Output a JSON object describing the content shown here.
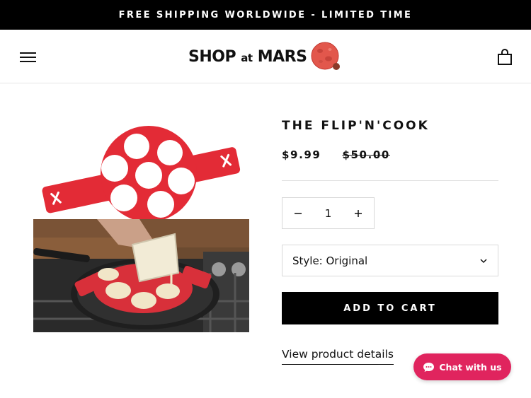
{
  "announcement": {
    "text": "FREE SHIPPING WORLDWIDE - LIMITED TIME"
  },
  "header": {
    "logo": {
      "main": "SHOP",
      "at": "at",
      "brand": "MARS"
    },
    "menu_icon": "hamburger-menu-icon",
    "cart_icon": "shopping-bag-icon"
  },
  "product": {
    "image_alt": "Red silicone pancake mold with seven circular holes",
    "title": "THE FLIP'N'COOK",
    "price": "$9.99",
    "compare_price": "$50.00",
    "quantity": {
      "value": "1",
      "minus_icon": "minus-icon",
      "plus_icon": "plus-icon"
    },
    "style_select": {
      "label": "Style: Original",
      "icon": "chevron-down-icon"
    },
    "add_to_cart": "ADD TO CART",
    "details_link": "View product details"
  },
  "chat": {
    "label": "Chat with us",
    "icon": "chat-bubble-icon",
    "color": "#e0245e"
  },
  "colors": {
    "accent": "#e0245e",
    "product_red": "#e32b36",
    "black": "#000000"
  }
}
